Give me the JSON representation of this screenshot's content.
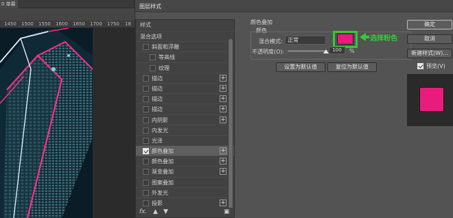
{
  "photoshop": {
    "tab_label": "0 单幕",
    "ruler_ticks": [
      "1450",
      "1500",
      "1550",
      "1600",
      "1650",
      "1700",
      "1750",
      "18"
    ]
  },
  "dialog": {
    "title": "图层样式",
    "style_panel": {
      "header": "样式",
      "items": [
        {
          "label": "混合选项",
          "indent": 0,
          "checkbox": false,
          "checked": false,
          "plus": false,
          "selected": false
        },
        {
          "label": "斜面和浮雕",
          "indent": 1,
          "checkbox": true,
          "checked": false,
          "plus": false,
          "selected": false
        },
        {
          "label": "等高线",
          "indent": 2,
          "checkbox": true,
          "checked": false,
          "plus": false,
          "selected": false
        },
        {
          "label": "纹理",
          "indent": 2,
          "checkbox": true,
          "checked": false,
          "plus": false,
          "selected": false
        },
        {
          "label": "描边",
          "indent": 1,
          "checkbox": true,
          "checked": false,
          "plus": true,
          "selected": false
        },
        {
          "label": "描边",
          "indent": 1,
          "checkbox": true,
          "checked": false,
          "plus": true,
          "selected": false
        },
        {
          "label": "描边",
          "indent": 1,
          "checkbox": true,
          "checked": false,
          "plus": true,
          "selected": false
        },
        {
          "label": "描边",
          "indent": 1,
          "checkbox": true,
          "checked": false,
          "plus": true,
          "selected": false
        },
        {
          "label": "内阴影",
          "indent": 1,
          "checkbox": true,
          "checked": false,
          "plus": true,
          "selected": false
        },
        {
          "label": "内发光",
          "indent": 1,
          "checkbox": true,
          "checked": false,
          "plus": false,
          "selected": false
        },
        {
          "label": "光泽",
          "indent": 1,
          "checkbox": true,
          "checked": false,
          "plus": false,
          "selected": false
        },
        {
          "label": "颜色叠加",
          "indent": 1,
          "checkbox": true,
          "checked": true,
          "plus": true,
          "selected": true
        },
        {
          "label": "颜色叠加",
          "indent": 1,
          "checkbox": true,
          "checked": false,
          "plus": true,
          "selected": false
        },
        {
          "label": "渐变叠加",
          "indent": 1,
          "checkbox": true,
          "checked": false,
          "plus": true,
          "selected": false
        },
        {
          "label": "图案叠加",
          "indent": 1,
          "checkbox": true,
          "checked": false,
          "plus": false,
          "selected": false
        },
        {
          "label": "外发光",
          "indent": 1,
          "checkbox": true,
          "checked": false,
          "plus": false,
          "selected": false
        },
        {
          "label": "投影",
          "indent": 1,
          "checkbox": true,
          "checked": false,
          "plus": true,
          "selected": false
        }
      ],
      "footer_fx": "fx."
    },
    "color_overlay": {
      "group_title": "颜色叠加",
      "sub_title": "颜色",
      "blend_label": "混合模式:",
      "blend_value": "正常",
      "swatch_color": "#ea1b7c",
      "annotation": "选择粉色",
      "annotation_color": "#33cc33",
      "opacity_label": "不透明度(O):",
      "opacity_value": "100",
      "opacity_unit": "%",
      "opacity_fraction": 1.0,
      "btn_set_default": "设置为默认值",
      "btn_reset_default": "复位为默认值"
    },
    "buttons": {
      "ok": "确定",
      "cancel": "取消",
      "new_style": "新建样式(W)...",
      "preview_label": "预览(V)",
      "preview_checked": true
    }
  }
}
